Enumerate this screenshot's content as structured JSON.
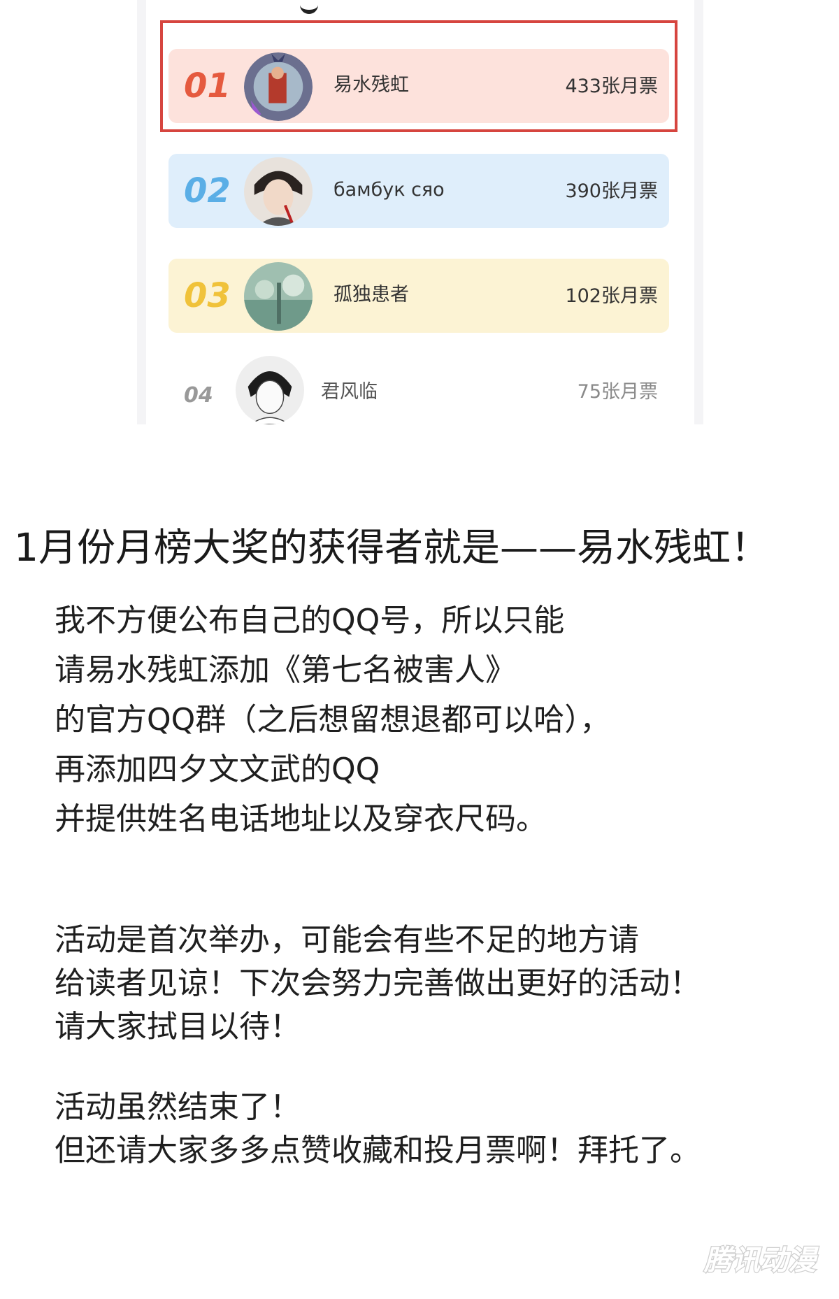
{
  "ranking": {
    "rows": [
      {
        "rank": "01",
        "name": "易水残虹",
        "votes": "433张月票",
        "rank_color": "#e55a3f"
      },
      {
        "rank": "02",
        "name": "бамбук сяо",
        "votes": "390张月票",
        "rank_color": "#5aaee6"
      },
      {
        "rank": "03",
        "name": "孤独患者",
        "votes": "102张月票",
        "rank_color": "#f0c23a"
      },
      {
        "rank": "04",
        "name": "君风临",
        "votes": "75张月票",
        "rank_color": "#999999"
      }
    ],
    "highlight_color": "#d6453f"
  },
  "announcement": {
    "headline": "1月份月榜大奖的获得者就是——易水残虹！",
    "paragraph1": [
      "我不方便公布自己的QQ号，所以只能",
      "请易水残虹添加《第七名被害人》",
      "的官方QQ群（之后想留想退都可以哈），",
      "再添加四夕文文武的QQ",
      "并提供姓名电话地址以及穿衣尺码。"
    ],
    "paragraph2": [
      "活动是首次举办，可能会有些不足的地方请",
      "给读者见谅！下次会努力完善做出更好的活动！",
      "请大家拭目以待！"
    ],
    "paragraph3": [
      "活动虽然结束了！",
      "但还请大家多多点赞收藏和投月票啊！拜托了。"
    ]
  },
  "watermark": {
    "text": "腾讯动漫"
  }
}
